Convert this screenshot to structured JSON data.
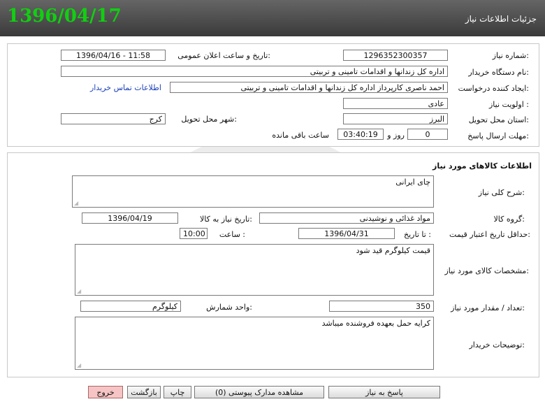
{
  "header": {
    "title": "جزئیات اطلاعات نیاز",
    "date": "1396/04/17"
  },
  "info": {
    "need_number_label": "شماره نیاز:",
    "need_number": "1296352300357",
    "announce_label": "تاریخ و ساعت اعلان عمومی:",
    "announce_value": "1396/04/16 - 11:58",
    "buyer_label": "نام دستگاه خریدار:",
    "buyer_value": "اداره کل زندانها و اقدامات تامینی و تربیتی",
    "creator_label": "ایجاد کننده درخواست:",
    "creator_value": "احمد ناصری کارپرداز اداره کل زندانها و اقدامات تامینی و تربیتی",
    "contact_link": "اطلاعات تماس خریدار",
    "priority_label": "اولویت نیاز :",
    "priority_value": "عادی",
    "province_label": "استان محل تحویل:",
    "province_value": "البرز",
    "city_label": "شهر محل تحویل:",
    "city_value": "کرج",
    "deadline_label": "مهلت ارسال پاسخ:",
    "days_value": "0",
    "days_unit": "روز و",
    "time_value": "03:40:19",
    "remaining": "ساعت باقی مانده"
  },
  "goods": {
    "section_title": "اطلاعات کالاهای مورد نیاز",
    "desc_label": "شرح کلی نیاز:",
    "desc_value": "چای ایرانی",
    "group_label": "گروه کالا:",
    "group_value": "مواد غذائی و نوشیدنی",
    "need_date_label": "تاریخ نیاز به کالا:",
    "need_date_value": "1396/04/19",
    "validity_label": "حداقل تاریخ اعتبار قیمت:",
    "until_label": "تا تاریخ :",
    "until_value": "1396/04/31",
    "hour_label": "ساعت :",
    "hour_value": "10:00",
    "spec_label": "مشخصات کالای مورد نیاز:",
    "spec_value": "قیمت کیلوگرم قید شود",
    "qty_label": "تعداد / مقدار مورد نیاز:",
    "qty_value": "350",
    "unit_label": "واحد شمارش:",
    "unit_value": "کیلوگرم",
    "notes_label": "توضیحات خریدار:",
    "notes_value": "کرایه حمل بعهده فروشنده میباشد"
  },
  "footer": {
    "reply": "پاسخ به نیاز",
    "attachments": "مشاهده مدارک پیوستی (0)",
    "print": "چاپ",
    "back": "بازگشت",
    "exit": "خروج"
  }
}
